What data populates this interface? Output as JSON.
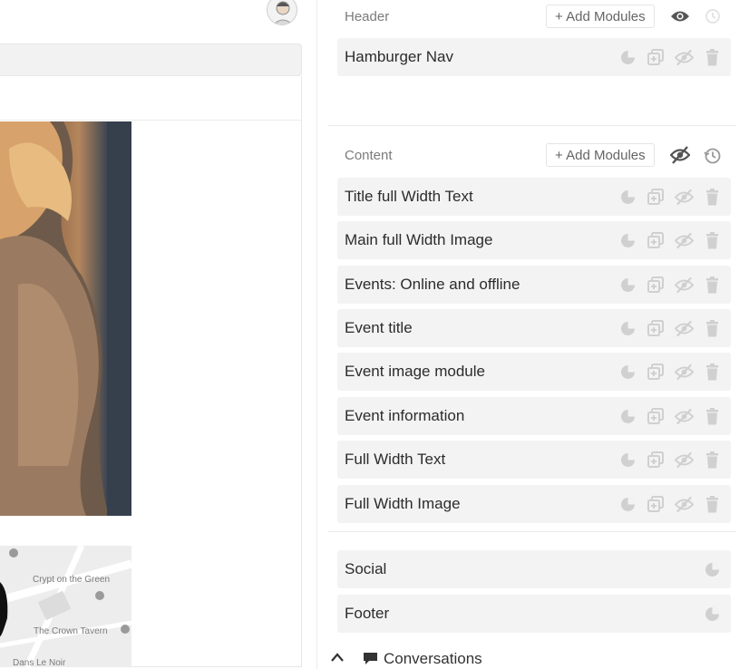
{
  "header_section": {
    "title": "Header",
    "add_label": "+ Add Modules",
    "visibility_icon": "eye-icon",
    "history_icon": "history-icon",
    "modules": [
      {
        "label": "Hamburger Nav"
      }
    ]
  },
  "content_section": {
    "title": "Content",
    "add_label": "+ Add Modules",
    "visibility_icon": "eye-off-icon",
    "history_icon": "history-icon",
    "modules": [
      {
        "label": "Title full Width Text"
      },
      {
        "label": "Main full Width Image"
      },
      {
        "label": "Events: Online and offline"
      },
      {
        "label": "Event title"
      },
      {
        "label": "Event image module"
      },
      {
        "label": "Event information"
      },
      {
        "label": "Full Width Text"
      },
      {
        "label": "Full Width Image"
      }
    ]
  },
  "footer_section": {
    "modules": [
      {
        "label": "Social"
      },
      {
        "label": "Footer"
      }
    ]
  },
  "module_actions": [
    "pie-chart-icon",
    "duplicate-icon",
    "eye-off-icon",
    "trash-icon"
  ],
  "map": {
    "places": [
      "Crypt on the Green",
      "The Crown Tavern",
      "Dans Le Noir"
    ]
  },
  "bottom_bar": {
    "conversations_label": "Conversations"
  },
  "colors": {
    "module_bg": "#f3f3f3",
    "icon_muted": "#cfcfcf",
    "icon_dark": "#555555"
  }
}
